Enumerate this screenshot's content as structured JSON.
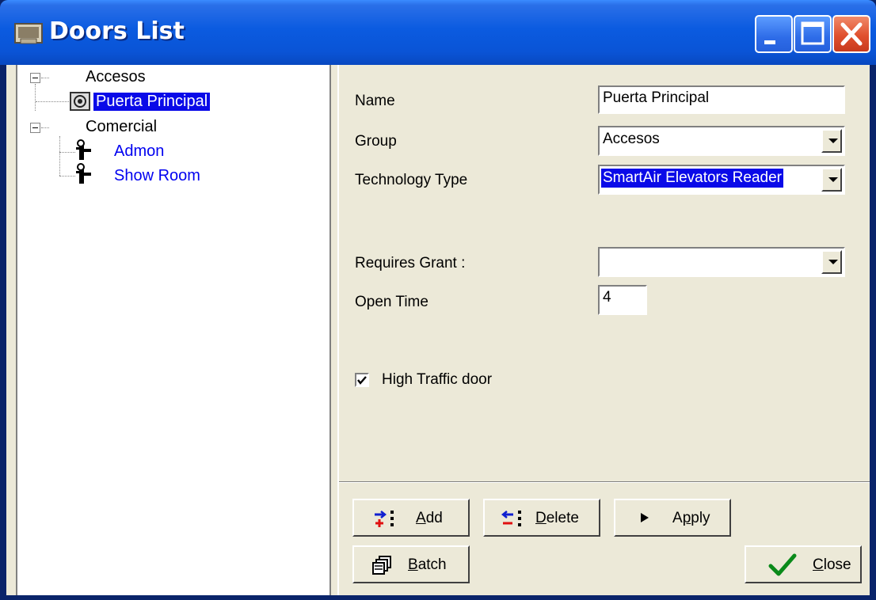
{
  "window": {
    "title": "Doors List",
    "title_icon": "app-window-icon",
    "controls": [
      "minimize-icon",
      "maximize-icon",
      "close-icon"
    ]
  },
  "tree": {
    "groups": [
      {
        "label": "Accesos",
        "children": [
          {
            "label": "Puerta Principal",
            "icon": "smartair-reader-icon",
            "selected": true
          }
        ]
      },
      {
        "label": "Comercial",
        "children": [
          {
            "label": "Admon",
            "icon": "door-lock-icon"
          },
          {
            "label": "Show Room",
            "icon": "door-lock-icon"
          }
        ]
      }
    ]
  },
  "form": {
    "name_label": "Name",
    "name_value": "Puerta Principal",
    "group_label": "Group",
    "group_value": "Accesos",
    "tech_label": "Technology Type",
    "tech_value": "SmartAir Elevators Reader",
    "grant_label": "Requires Grant :",
    "grant_value": "",
    "open_time_label": "Open Time",
    "open_time_value": "4",
    "high_traffic_label": "High Traffic door",
    "high_traffic_checked": true
  },
  "buttons": {
    "add": {
      "accel": "A",
      "rest": "dd"
    },
    "delete": {
      "accel": "D",
      "rest": "elete"
    },
    "apply": {
      "pre": "A",
      "accel": "p",
      "rest": "ply"
    },
    "batch": {
      "accel": "B",
      "rest": "atch"
    },
    "close": {
      "accel": "C",
      "rest": "lose"
    }
  },
  "colors": {
    "selection": "#0A0AE8",
    "link_blue": "#0000F0",
    "window_face": "#ECE9D8",
    "titlebar": "#0A54D6"
  }
}
